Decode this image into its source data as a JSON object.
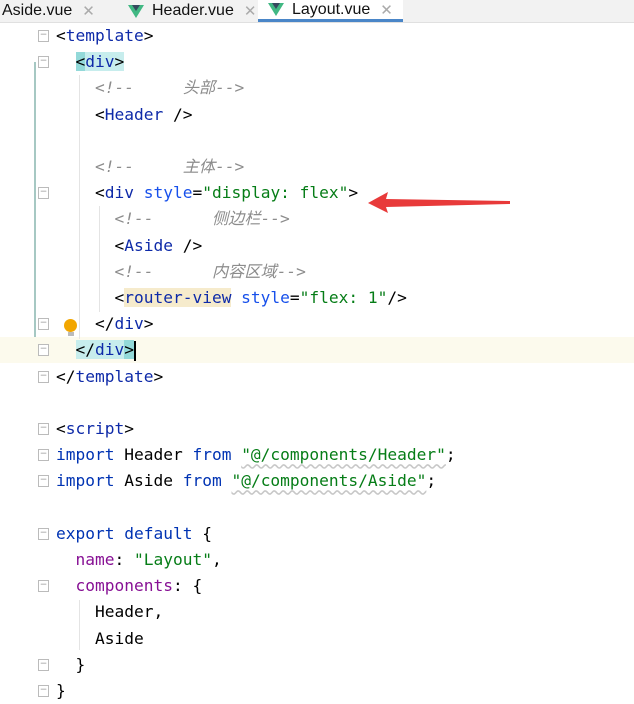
{
  "tabs": [
    {
      "label": "Aside.vue",
      "active": false
    },
    {
      "label": "Header.vue",
      "active": false
    },
    {
      "label": "Layout.vue",
      "active": true
    }
  ],
  "icons": {
    "tab_icon": "vue-logo-icon",
    "close": "close-icon",
    "fold": "fold-marker-icon",
    "bulb": "lightbulb-icon",
    "annotation": "red-arrow"
  },
  "colors": {
    "active_tab_underline": "#4a86c8",
    "arrow": "#e83a3a",
    "tag_highlight": "#c7eded",
    "current_line": "#fcfaed"
  },
  "lines": [
    [
      [
        "<",
        "br"
      ],
      [
        "template",
        "tag"
      ],
      [
        ">",
        "br"
      ]
    ],
    [
      [
        "  ",
        "plain"
      ],
      [
        "<",
        "br hl-tag first"
      ],
      [
        "div",
        "tag hl-tag"
      ],
      [
        ">",
        "br hl-tag"
      ]
    ],
    [
      [
        "    ",
        "plain"
      ],
      [
        "<!--     头部-->",
        "com"
      ]
    ],
    [
      [
        "    ",
        "plain"
      ],
      [
        "<",
        "br"
      ],
      [
        "Header",
        "tag"
      ],
      [
        " />",
        "br"
      ]
    ],
    [],
    [
      [
        "    ",
        "plain"
      ],
      [
        "<!--     主体-->",
        "com"
      ]
    ],
    [
      [
        "    ",
        "plain"
      ],
      [
        "<",
        "br"
      ],
      [
        "div",
        "tag"
      ],
      [
        " style",
        "attr"
      ],
      [
        "=",
        "br"
      ],
      [
        "\"display: flex\"",
        "str"
      ],
      [
        ">",
        "br"
      ]
    ],
    [
      [
        "      ",
        "plain"
      ],
      [
        "<!--      侧边栏-->",
        "com"
      ]
    ],
    [
      [
        "      ",
        "plain"
      ],
      [
        "<",
        "br"
      ],
      [
        "Aside",
        "tag"
      ],
      [
        " />",
        "br"
      ]
    ],
    [
      [
        "      ",
        "plain"
      ],
      [
        "<!--      内容区域-->",
        "com"
      ]
    ],
    [
      [
        "      ",
        "plain"
      ],
      [
        "<",
        "br"
      ],
      [
        "router-view",
        "tag hl-rv"
      ],
      [
        " style",
        "attr"
      ],
      [
        "=",
        "br"
      ],
      [
        "\"flex: 1\"",
        "str"
      ],
      [
        "/>",
        "br"
      ]
    ],
    [
      [
        "    ",
        "plain"
      ],
      [
        "</",
        "br"
      ],
      [
        "div",
        "tag"
      ],
      [
        ">",
        "br"
      ]
    ],
    [
      [
        "  ",
        "plain"
      ],
      [
        "</",
        "br hl-tag"
      ],
      [
        "div",
        "tag hl-tag"
      ],
      [
        ">",
        "br hl-tag first"
      ]
    ],
    [
      [
        "</",
        "br"
      ],
      [
        "template",
        "tag"
      ],
      [
        ">",
        "br"
      ]
    ],
    [],
    [
      [
        "<",
        "br"
      ],
      [
        "script",
        "tag"
      ],
      [
        ">",
        "br"
      ]
    ],
    [
      [
        "import",
        "kw"
      ],
      [
        " Header ",
        "id"
      ],
      [
        "from",
        "kw"
      ],
      [
        " ",
        "plain"
      ],
      [
        "\"@/components/Header\"",
        "str u"
      ],
      [
        ";",
        "br"
      ]
    ],
    [
      [
        "import",
        "kw"
      ],
      [
        " Aside ",
        "id"
      ],
      [
        "from",
        "kw"
      ],
      [
        " ",
        "plain"
      ],
      [
        "\"@/components/Aside\"",
        "str u"
      ],
      [
        ";",
        "br"
      ]
    ],
    [],
    [
      [
        "export default",
        "kw"
      ],
      [
        " {",
        "br"
      ]
    ],
    [
      [
        "  ",
        "plain"
      ],
      [
        "name",
        "prop"
      ],
      [
        ": ",
        "br"
      ],
      [
        "\"Layout\"",
        "str"
      ],
      [
        ",",
        "br"
      ]
    ],
    [
      [
        "  ",
        "plain"
      ],
      [
        "components",
        "prop"
      ],
      [
        ": {",
        "br"
      ]
    ],
    [
      [
        "    Header,",
        "id"
      ]
    ],
    [
      [
        "    Aside",
        "id"
      ]
    ],
    [
      [
        "  }",
        "br"
      ]
    ],
    [
      [
        "}",
        "br"
      ]
    ]
  ],
  "folds": [
    0,
    1,
    6,
    11,
    12,
    13,
    15,
    16,
    17,
    19,
    21,
    24,
    25
  ],
  "current_line": 12
}
